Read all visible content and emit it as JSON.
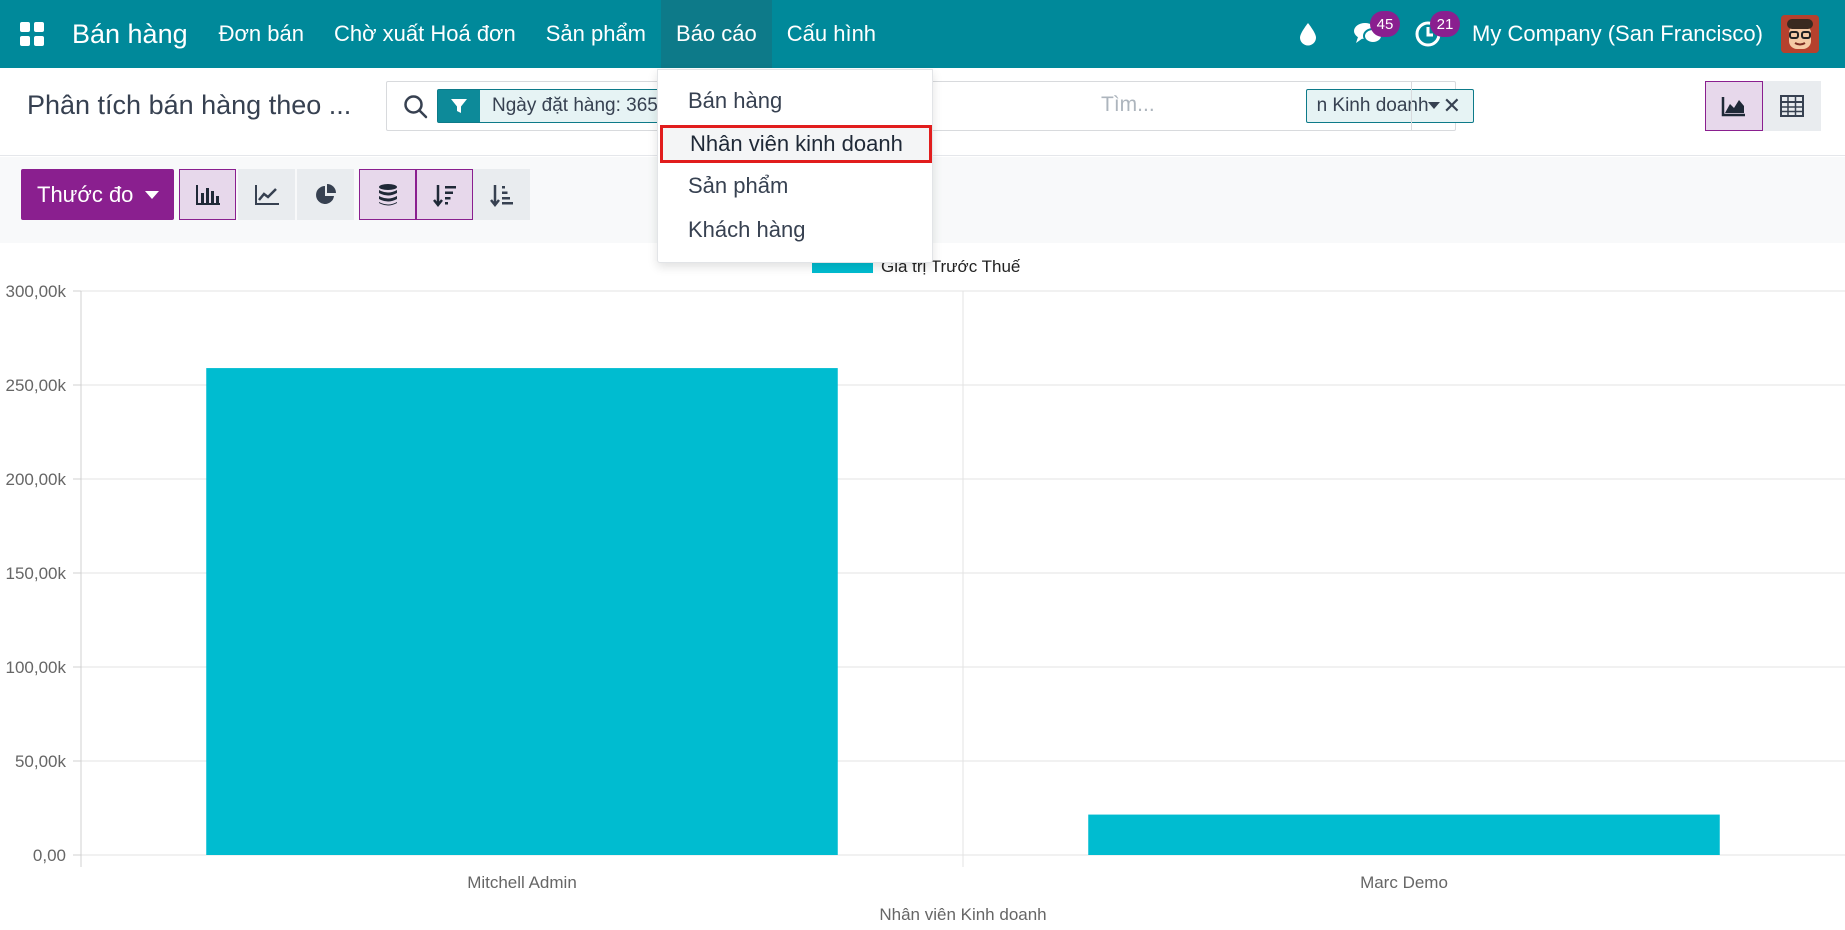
{
  "navbar": {
    "brand": "Bán hàng",
    "menu": [
      "Đơn bán",
      "Chờ xuất Hoá đơn",
      "Sản phẩm",
      "Báo cáo",
      "Cấu hình"
    ],
    "messages_count": "45",
    "activities_count": "21",
    "company": "My Company (San Francisco)"
  },
  "control": {
    "title": "Phân tích bán hàng theo ...",
    "filter_facet": "Ngày đặt hàng: 365",
    "groupby_facet": "n Kinh doanh",
    "search_placeholder": "Tìm..."
  },
  "toolbar": {
    "measure_label": "Thước đo"
  },
  "dropdown": {
    "items": [
      "Bán hàng",
      "Nhân viên kinh doanh",
      "Sản phẩm",
      "Khách hàng"
    ],
    "highlighted": "Nhân viên kinh doanh"
  },
  "chart_data": {
    "type": "bar",
    "categories": [
      "Mitchell Admin",
      "Marc Demo"
    ],
    "series": [
      {
        "name": "Giá trị Trước Thuế",
        "values": [
          259000,
          21500
        ]
      }
    ],
    "xlabel": "Nhân viên Kinh doanh",
    "ylabel": "",
    "ylim": [
      0,
      300000
    ],
    "yticks": [
      "0,00",
      "50,00k",
      "100,00k",
      "150,00k",
      "200,00k",
      "250,00k",
      "300,00k"
    ],
    "grid": true,
    "legend": "top-center",
    "color": "#00bcd0"
  }
}
